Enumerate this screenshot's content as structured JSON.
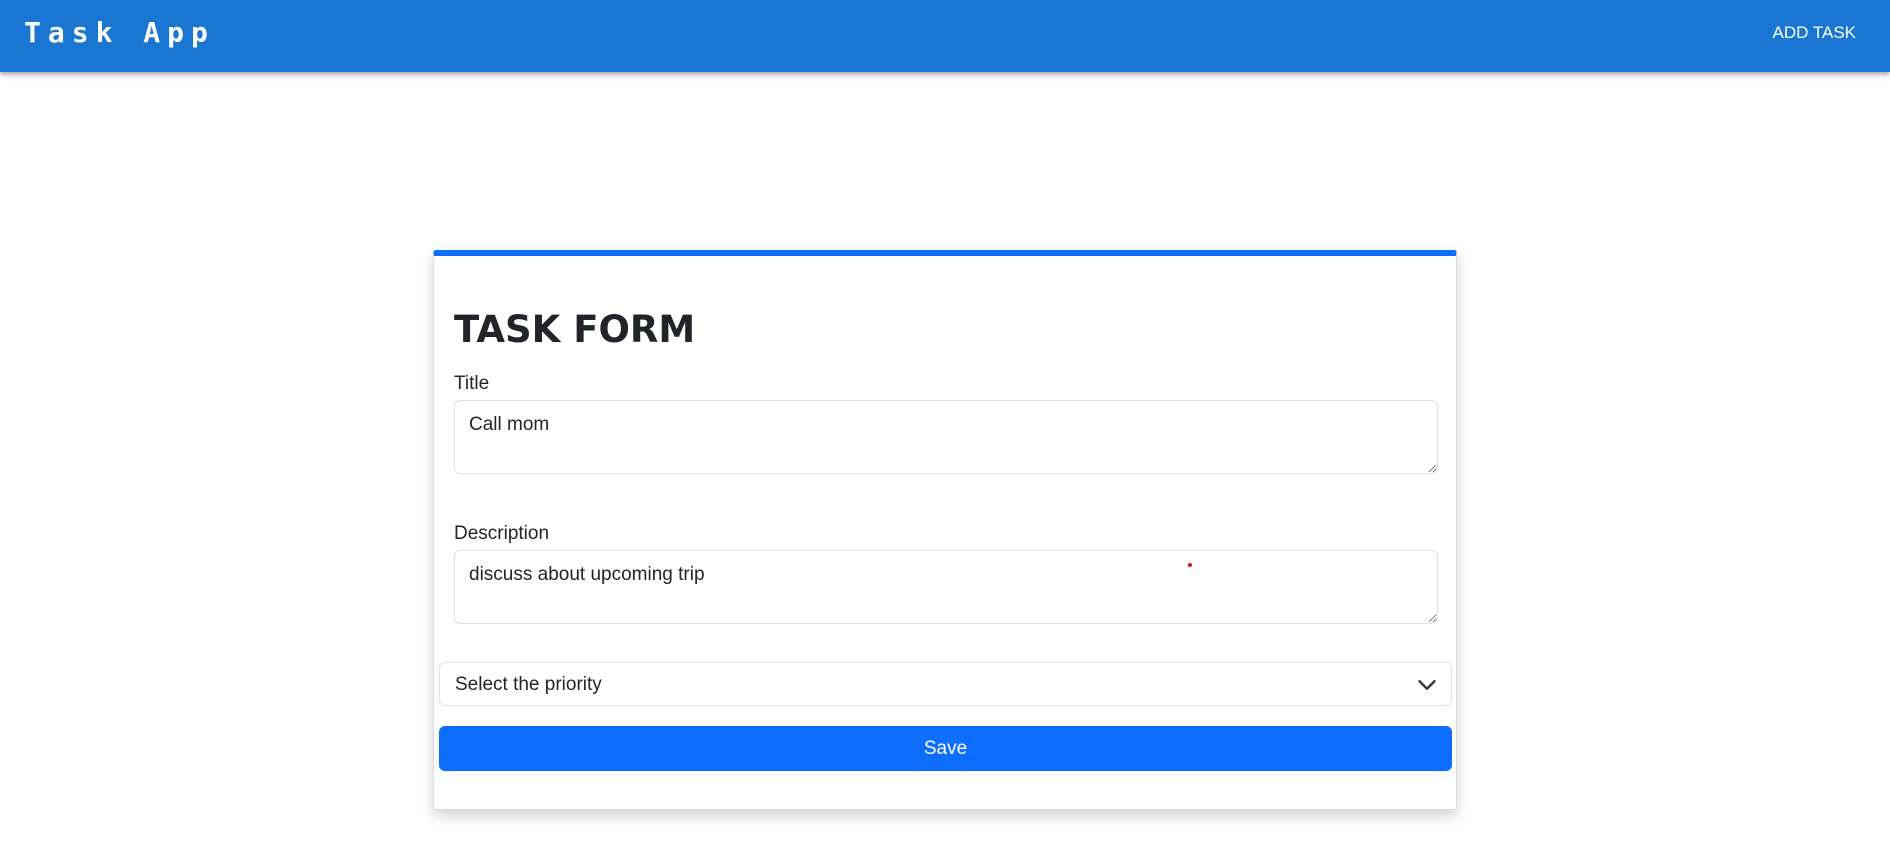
{
  "header": {
    "brand": "Task App",
    "add_task_label": "ADD TASK"
  },
  "form": {
    "heading": "TASK FORM",
    "title_label": "Title",
    "title_value": "Call mom",
    "description_label": "Description",
    "description_value": "discuss about upcoming trip",
    "priority_selected": "Select the priority",
    "save_label": "Save"
  },
  "icons": {
    "select_arrow": "chevron-down-icon"
  },
  "colors": {
    "appbar": "#1976d2",
    "accent": "#0d6efd",
    "pointer": "#e01010"
  }
}
